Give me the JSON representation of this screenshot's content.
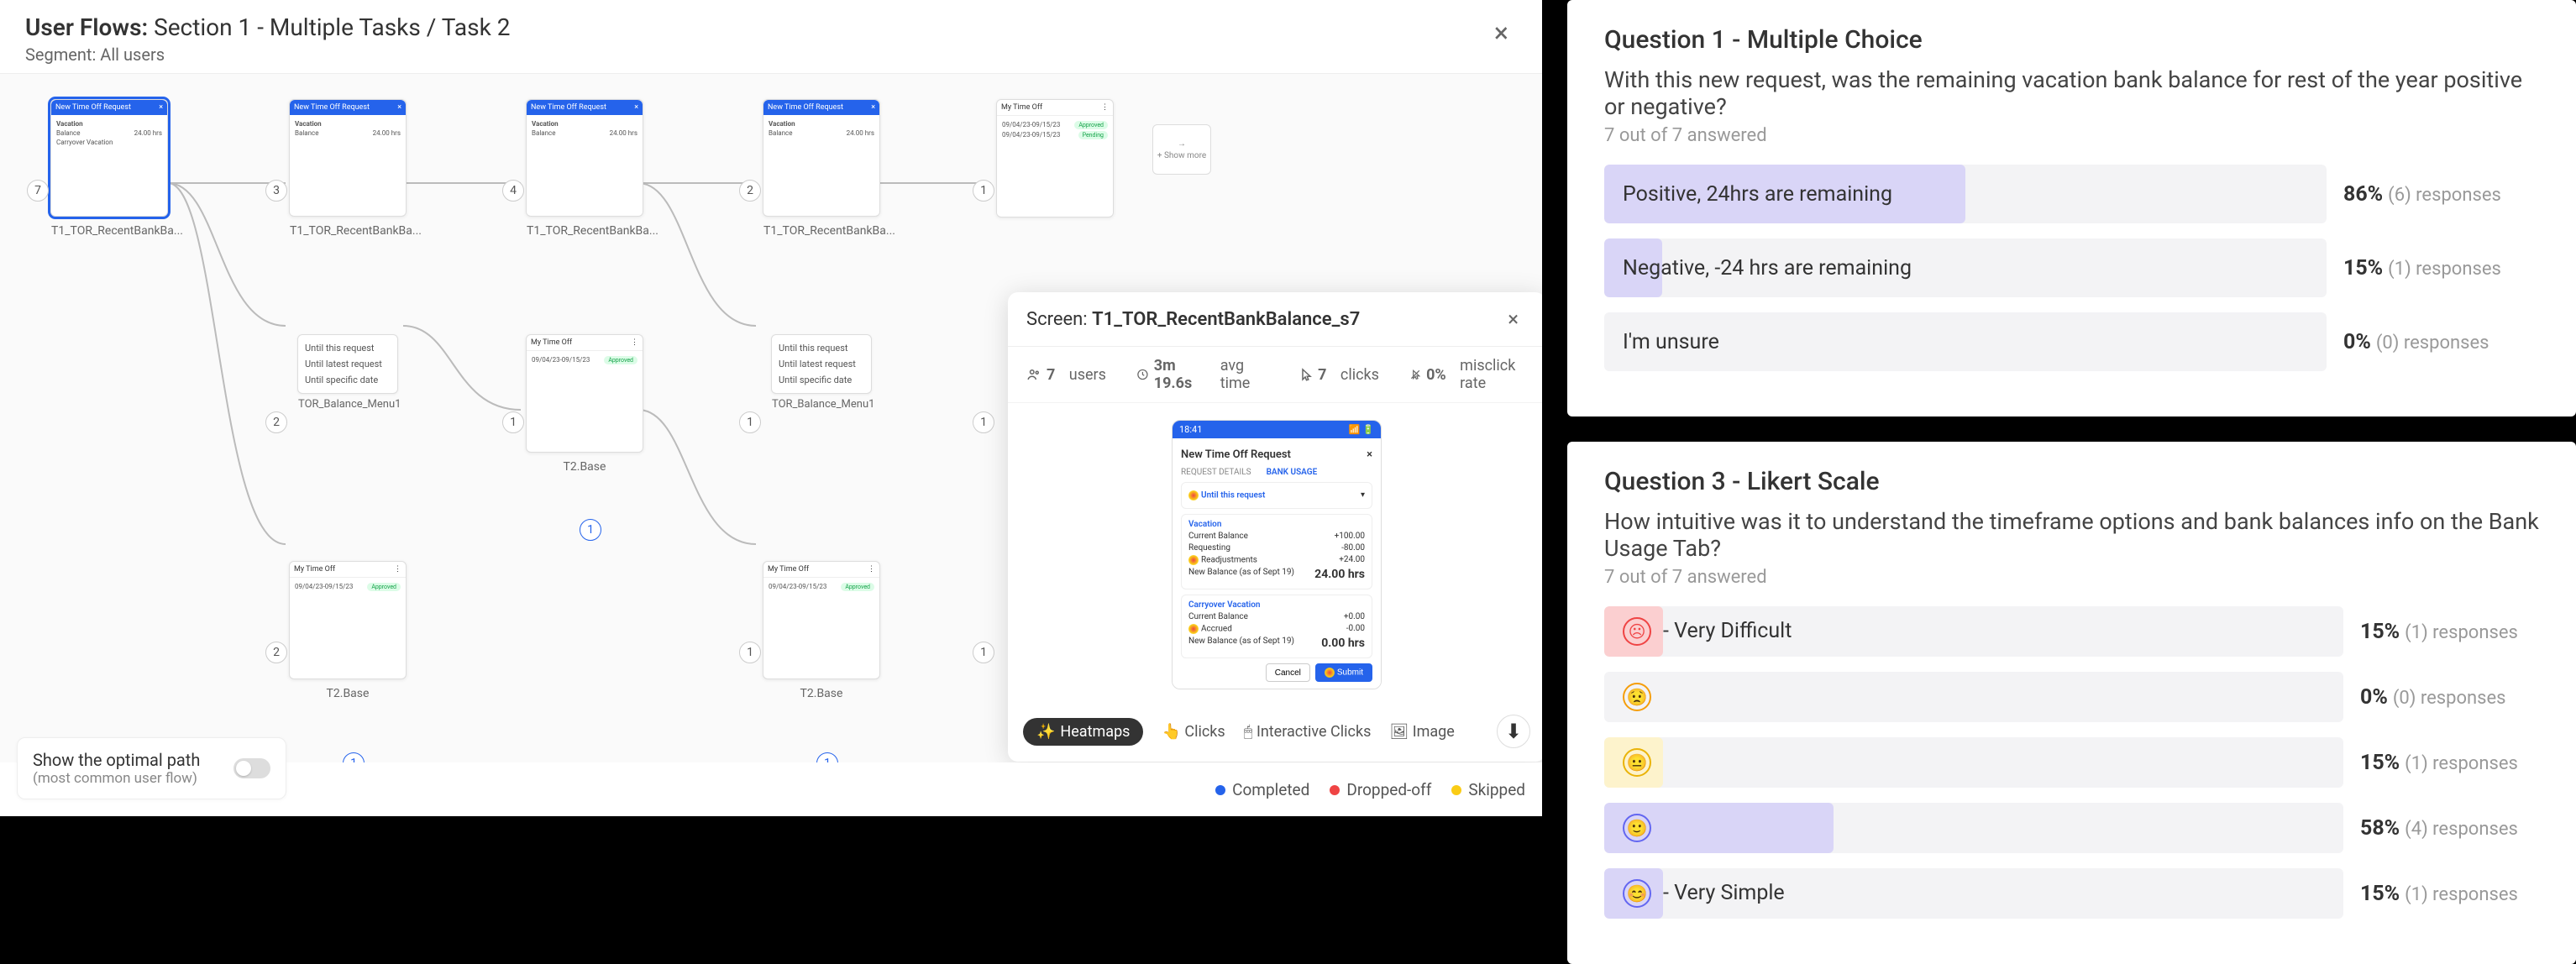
{
  "header": {
    "title_prefix": "User Flows:",
    "title": "Section 1 - Multiple Tasks / Task 2",
    "segment_label": "Segment:",
    "segment_value": "All users"
  },
  "flow": {
    "nodes": {
      "n1": {
        "title": "New Time Off Request",
        "label": "T1_TOR_RecentBankBa...",
        "count": "7"
      },
      "n2": {
        "title": "New Time Off Request",
        "label": "T1_TOR_RecentBankBa...",
        "count": "3"
      },
      "n3": {
        "title": "New Time Off Request",
        "label": "T1_TOR_RecentBankBa...",
        "count": "4"
      },
      "n4": {
        "title": "New Time Off Request",
        "label": "T1_TOR_RecentBankBa...",
        "count": "2"
      },
      "n5": {
        "title": "My Time Off",
        "label": "",
        "count": "1"
      },
      "m1": {
        "items": [
          "Until this request",
          "Until latest request",
          "Until specific date"
        ],
        "label": "TOR_Balance_Menu1",
        "count": "2"
      },
      "m2": {
        "items": [
          "Until this request",
          "Until latest request",
          "Until specific date"
        ],
        "label": "TOR_Balance_Menu1",
        "count": "1"
      },
      "p6": {
        "title": "My Time Off",
        "label": "T2.Base",
        "count": "1"
      },
      "p7": {
        "title": "My Time Off",
        "label": "T2.Base",
        "count": "2"
      },
      "p8": {
        "title": "My Time Off",
        "label": "T2.Base",
        "count": "1"
      },
      "more": "+ Show more"
    },
    "balance": "24.00 hrs",
    "badges": {
      "b1": "1",
      "b2": "1",
      "b3": "1",
      "b4": "1",
      "b5": "1",
      "b6": "1"
    }
  },
  "detail": {
    "prefix": "Screen:",
    "name": "T1_TOR_RecentBankBalance_s7",
    "stats": {
      "users": "7",
      "users_label": "users",
      "time": "3m 19.6s",
      "time_label": "avg time",
      "clicks": "7",
      "clicks_label": "clicks",
      "misclick": "0%",
      "misclick_label": "misclick rate"
    },
    "phone": {
      "time": "18:41",
      "title": "New Time Off Request",
      "tabs": {
        "details": "REQUEST DETAILS",
        "bank": "BANK USAGE"
      },
      "until": "Until this request",
      "sections": [
        {
          "name": "Vacation",
          "rows": [
            [
              "Current Balance",
              "+100.00"
            ],
            [
              "Requesting",
              "-80.00"
            ],
            [
              "Readjustments",
              "+24.00"
            ]
          ],
          "newbal_label": "New Balance (as of Sept 19)",
          "newbal": "24.00 hrs"
        },
        {
          "name": "Carryover Vacation",
          "rows": [
            [
              "Current Balance",
              "+0.00"
            ],
            [
              "Accrued",
              "-0.00"
            ]
          ],
          "newbal_label": "New Balance (as of Sept 19)",
          "newbal": "0.00 hrs"
        }
      ],
      "cancel": "Cancel",
      "submit": "Submit"
    },
    "toolbar": {
      "heatmaps": "Heatmaps",
      "clicks": "Clicks",
      "interactive": "Interactive Clicks",
      "image": "Image"
    }
  },
  "optimal": {
    "title": "Show the optimal path",
    "subtitle": "(most common user flow)"
  },
  "legend": {
    "completed": "Completed",
    "dropped": "Dropped-off",
    "skipped": "Skipped"
  },
  "q1": {
    "title": "Question 1 - Multiple Choice",
    "question": "With this new request, was the remaining vacation bank balance for rest of the year positive or negative?",
    "answered": "7 out of 7 answered",
    "options": [
      {
        "text": "Positive, 24hrs are remaining",
        "pct": "86%",
        "resp": "(6) responses",
        "fill": 50
      },
      {
        "text": "Negative, -24 hrs are remaining",
        "pct": "15%",
        "resp": "(1) responses",
        "fill": 8
      },
      {
        "text": "I'm unsure",
        "pct": "0%",
        "resp": "(0) responses",
        "fill": 0
      }
    ]
  },
  "q3": {
    "title": "Question 3 - Likert Scale",
    "question": "How intuitive was it to understand the timeframe options and bank balances info on the Bank Usage Tab?",
    "answered": "7 out of 7 answered",
    "options": [
      {
        "text": "- Very Difficult",
        "pct": "15%",
        "resp": "(1) responses",
        "fill": 8,
        "color": "red"
      },
      {
        "text": "",
        "pct": "0%",
        "resp": "(0) responses",
        "fill": 0,
        "color": "orange"
      },
      {
        "text": "",
        "pct": "15%",
        "resp": "(1) responses",
        "fill": 8,
        "color": "yellow"
      },
      {
        "text": "",
        "pct": "58%",
        "resp": "(4) responses",
        "fill": 31,
        "color": "blue"
      },
      {
        "text": "- Very Simple",
        "pct": "15%",
        "resp": "(1) responses",
        "fill": 8,
        "color": "blue"
      }
    ]
  }
}
